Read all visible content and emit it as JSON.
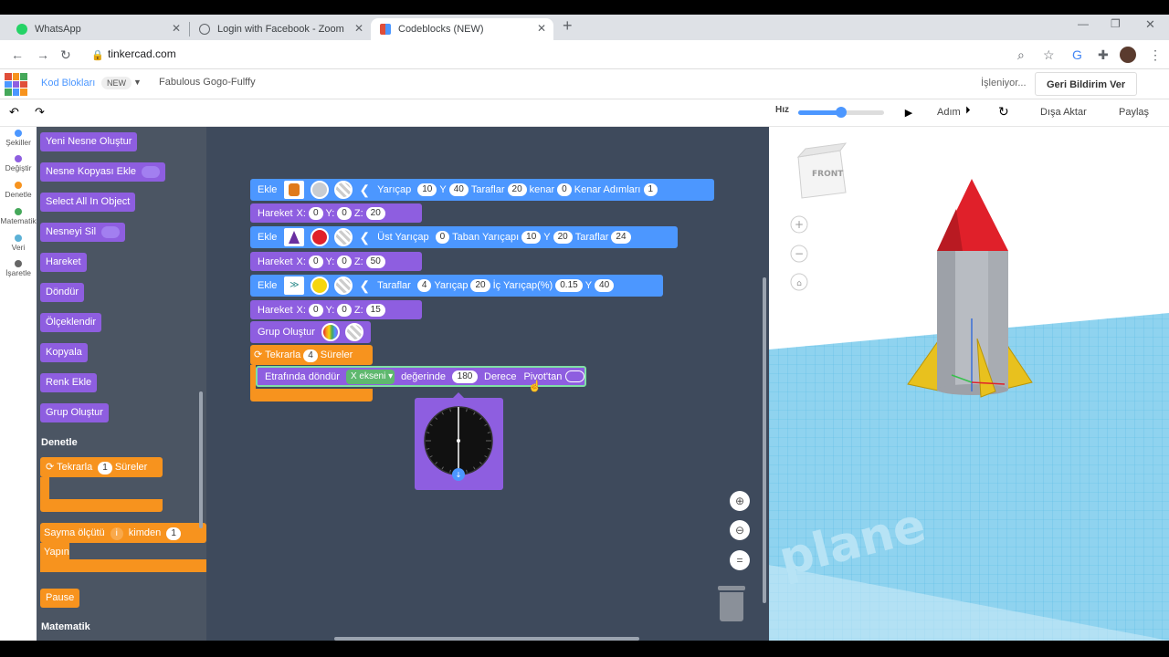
{
  "browser": {
    "tabs": [
      {
        "label": "WhatsApp",
        "icon": "whatsapp-icon",
        "color": "#25d366"
      },
      {
        "label": "Login with Facebook - Zoom",
        "icon": "globe-icon",
        "color": "#5f6368"
      },
      {
        "label": "Codeblocks (NEW)",
        "icon": "tinkercad-icon",
        "color": "#e04e39"
      }
    ],
    "url": "tinkercad.com"
  },
  "header": {
    "logo_letters": [
      "T",
      "IN",
      "K",
      "ER",
      "CA",
      "D"
    ],
    "kod_bloklari": "Kod Blokları",
    "new_badge": "NEW",
    "project_name": "Fabulous Gogo-Fulffy",
    "status": "İşleniyor...",
    "feedback_button": "Geri Bildirim Ver"
  },
  "toolbar": {
    "speed_label": "Hız",
    "speed_value": 0.5,
    "step_label": "Adım",
    "export_label": "Dışa Aktar",
    "share_label": "Paylaş"
  },
  "categories": [
    {
      "label": "Şekiller",
      "color": "#4c97ff"
    },
    {
      "label": "Değiştir",
      "color": "#8e5ee0"
    },
    {
      "label": "Denetle",
      "color": "#f7931e"
    },
    {
      "label": "Matematik",
      "color": "#45a85a"
    },
    {
      "label": "Veri",
      "color": "#5cb1d6"
    },
    {
      "label": "İşaretle",
      "color": "#666666"
    }
  ],
  "flyout": {
    "blocks": [
      "Yeni Nesne Oluştur",
      "Nesne Kopyası Ekle",
      "Select All In Object",
      "Nesneyi Sil",
      "Hareket",
      "Döndür",
      "Ölçeklendir",
      "Kopyala",
      "Renk Ekle",
      "Grup Oluştur"
    ],
    "denetle_title": "Denetle",
    "repeat_label": "Tekrarla",
    "repeat_count": "1",
    "repeat_suffix": "Süreler",
    "count_label": "Sayma ölçütü",
    "count_var": "i",
    "count_from": "kimden",
    "count_from_val": "1",
    "do_label": "Yapın",
    "pause_label": "Pause",
    "matematik_title": "Matematik"
  },
  "script": {
    "row1": {
      "add": "Ekle",
      "radius": "Yarıçap",
      "r": "10",
      "y": "Y",
      "yv": "40",
      "sides": "Taraflar",
      "sv": "20",
      "edge": "kenar",
      "ev": "0",
      "steps": "Kenar Adımları",
      "stv": "1"
    },
    "move1": {
      "label": "Hareket",
      "x": "X:",
      "xv": "0",
      "y": "Y:",
      "yv": "0",
      "z": "Z:",
      "zv": "20"
    },
    "row2": {
      "add": "Ekle",
      "top_radius": "Üst Yarıçap",
      "tr": "0",
      "base_radius": "Taban Yarıçapı",
      "br": "10",
      "y": "Y",
      "yv": "20",
      "sides": "Taraflar",
      "sv": "24"
    },
    "move2": {
      "label": "Hareket",
      "x": "X:",
      "xv": "0",
      "y": "Y:",
      "yv": "0",
      "z": "Z:",
      "zv": "50"
    },
    "row3": {
      "add": "Ekle",
      "sides": "Taraflar",
      "sv": "4",
      "radius": "Yarıçap",
      "rv": "20",
      "inner": "İç Yarıçap(%)",
      "iv": "0.15",
      "y": "Y",
      "yv": "40"
    },
    "move3": {
      "label": "Hareket",
      "x": "X:",
      "xv": "0",
      "y": "Y:",
      "yv": "0",
      "z": "Z:",
      "zv": "15"
    },
    "group": "Grup Oluştur",
    "repeat": {
      "label": "Tekrarla",
      "count": "4",
      "suffix": "Süreler"
    },
    "rotate": {
      "label": "Etrafında döndür",
      "axis": "X ekseni",
      "in": "değerinde",
      "deg": "180",
      "deg_label": "Derece",
      "pivot": "Pivot'tan"
    },
    "dial_value_deg": 180
  },
  "scene": {
    "front_label": "FRONT",
    "plane_text": "plane",
    "colors": {
      "cone": "#e0202a",
      "body": "#b8bcc2",
      "fins": "#e8c11e",
      "grid": "#7fd0ef"
    }
  }
}
